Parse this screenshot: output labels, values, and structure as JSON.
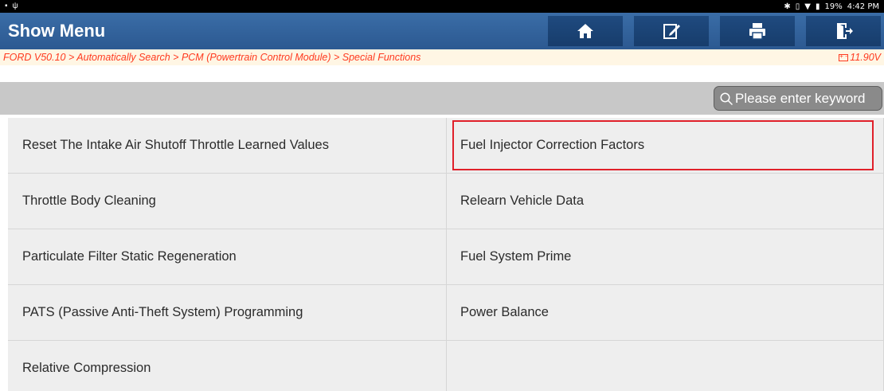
{
  "statusbar": {
    "battery": "19%",
    "time": "4:42 PM"
  },
  "header": {
    "title": "Show Menu"
  },
  "breadcrumb": {
    "path": "FORD V50.10 > Automatically Search > PCM (Powertrain Control Module) > Special Functions",
    "voltage": "11.90V"
  },
  "search": {
    "placeholder": "Please enter keyword"
  },
  "menu": {
    "items": [
      "Reset The Intake Air Shutoff Throttle Learned Values",
      "Fuel Injector Correction Factors",
      "Throttle Body Cleaning",
      "Relearn Vehicle Data",
      "Particulate Filter Static Regeneration",
      "Fuel System Prime",
      "PATS (Passive Anti-Theft System) Programming",
      "Power Balance",
      "Relative Compression",
      ""
    ],
    "selected": "Fuel Injector Correction Factors",
    "highlight_color": "#e0202a"
  },
  "toolbar": {
    "icons": [
      "home-icon",
      "edit-icon",
      "print-icon",
      "exit-icon"
    ]
  },
  "colors": {
    "titlebar": "#2c5991",
    "breadcrumb_text": "#ff3a1f"
  }
}
